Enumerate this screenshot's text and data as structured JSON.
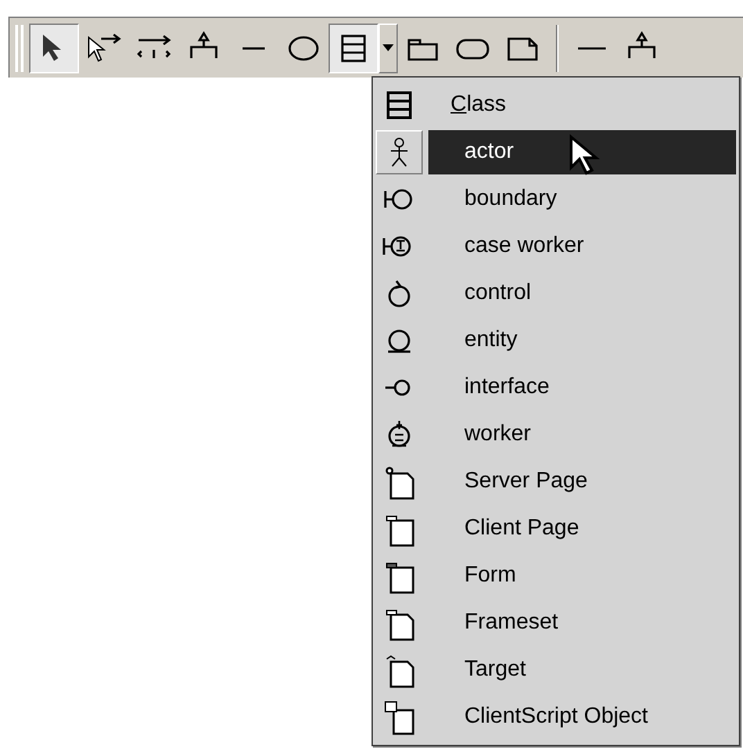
{
  "toolbar": {
    "groups": [
      {
        "tools": [
          {
            "selected": true
          },
          {
            "selected": false
          },
          {
            "selected": false
          },
          {
            "selected": false
          },
          {
            "selected": false
          },
          {
            "selected": false
          },
          {
            "selected": true,
            "dropdown": true
          },
          {
            "selected": false
          },
          {
            "selected": false
          },
          {
            "selected": false
          }
        ]
      },
      {
        "tools": [
          {
            "selected": false
          },
          {
            "selected": false
          }
        ]
      }
    ]
  },
  "menu": {
    "items": [
      {
        "label": "Class",
        "underline_first_letter": true,
        "selected": false
      },
      {
        "label": "actor",
        "selected": true
      },
      {
        "label": "boundary",
        "selected": false
      },
      {
        "label": "case worker",
        "selected": false
      },
      {
        "label": "control",
        "selected": false
      },
      {
        "label": "entity",
        "selected": false
      },
      {
        "label": "interface",
        "selected": false
      },
      {
        "label": "worker",
        "selected": false
      },
      {
        "label": "Server Page",
        "selected": false
      },
      {
        "label": "Client Page",
        "selected": false
      },
      {
        "label": "Form",
        "selected": false
      },
      {
        "label": "Frameset",
        "selected": false
      },
      {
        "label": "Target",
        "selected": false
      },
      {
        "label": "ClientScript Object",
        "selected": false
      }
    ]
  }
}
